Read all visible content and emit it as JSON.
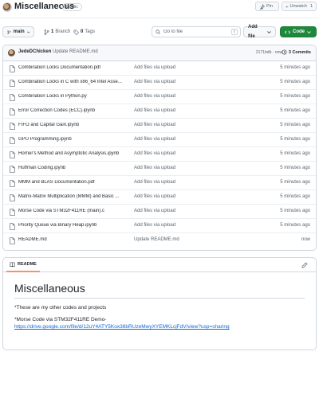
{
  "repo": {
    "name": "Miscellaneous",
    "visibility": "Public",
    "pin_label": "Pin",
    "unwatch_label": "Unwatch",
    "unwatch_count": "1"
  },
  "branchbar": {
    "branch": "main",
    "branches_count": "1",
    "branches_label": "Branch",
    "tags_count": "0",
    "tags_label": "Tags",
    "goto_placeholder": "Go to file",
    "goto_kbd": "t",
    "add_file_label": "Add file",
    "code_label": "Code"
  },
  "commit": {
    "author": "JedeDChicken",
    "message": "Update README.md",
    "hash_time": "2171bdb · now",
    "commits_label": "3 Commits"
  },
  "files": [
    {
      "name": "Combination Locks Documentation.pdf",
      "message": "Add files via upload",
      "age": "5 minutes ago"
    },
    {
      "name": "Combination Locks in C with x86_64 Intel Asse...",
      "message": "Add files via upload",
      "age": "5 minutes ago"
    },
    {
      "name": "Combination Locks in Python.py",
      "message": "Add files via upload",
      "age": "5 minutes ago"
    },
    {
      "name": "Error Correction Codes (ECC).ipynb",
      "message": "Add files via upload",
      "age": "5 minutes ago"
    },
    {
      "name": "FIFO and Capital Gain.ipynb",
      "message": "Add files via upload",
      "age": "5 minutes ago"
    },
    {
      "name": "GPU Programming.ipynb",
      "message": "Add files via upload",
      "age": "5 minutes ago"
    },
    {
      "name": "Horner's Method and Asymptotic Analysis.ipynb",
      "message": "Add files via upload",
      "age": "5 minutes ago"
    },
    {
      "name": "Huffman Coding.ipynb",
      "message": "Add files via upload",
      "age": "5 minutes ago"
    },
    {
      "name": "MMM and BLAS Documentation.pdf",
      "message": "Add files via upload",
      "age": "5 minutes ago"
    },
    {
      "name": "Matrix-Matrix Multiplication (MMM) and Basic ...",
      "message": "Add files via upload",
      "age": "5 minutes ago"
    },
    {
      "name": "Morse Code via STM32F411RE (main).c",
      "message": "Add files via upload",
      "age": "5 minutes ago"
    },
    {
      "name": "Priority Queue via Binary Heap.ipynb",
      "message": "Add files via upload",
      "age": "5 minutes ago"
    },
    {
      "name": "README.md",
      "message": "Update README.md",
      "age": "now"
    }
  ],
  "readme": {
    "tab_label": "README",
    "title": "Miscellaneous",
    "line1": "*These are my other codes and projects",
    "line2": "*Morse Code via STM32F411RE Demo-",
    "link": "https://drive.google.com/file/d/12uY4ATY5Kox38bRUzeMwyXYEMKLcjFdV/view?usp=sharing"
  },
  "colors": {
    "accent_green": "#1f883d",
    "link_blue": "#0969da",
    "muted": "#59636e"
  },
  "icons": [
    "pin-icon",
    "eye-icon",
    "branch-icon",
    "tag-icon",
    "search-icon",
    "code-icon",
    "history-icon",
    "file-icon",
    "book-icon",
    "pencil-icon"
  ]
}
